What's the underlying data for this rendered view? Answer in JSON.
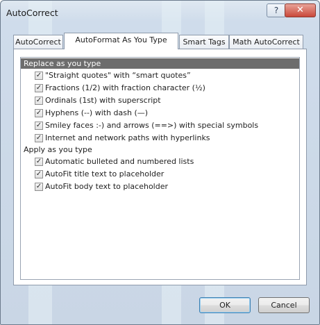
{
  "window": {
    "title": "AutoCorrect"
  },
  "titlebar": {
    "help_glyph": "?",
    "close_glyph": "✕"
  },
  "tabs": [
    {
      "label": "AutoCorrect",
      "active": false
    },
    {
      "label": "AutoFormat As You Type",
      "active": true
    },
    {
      "label": "Smart Tags",
      "active": false
    },
    {
      "label": "Math AutoCorrect",
      "active": false
    }
  ],
  "groups": {
    "replace": {
      "label": "Replace as you type",
      "selected": true,
      "items": [
        {
          "label": "\"Straight quotes\" with “smart quotes”",
          "checked": true
        },
        {
          "label": "Fractions (1/2) with fraction character (½)",
          "checked": true
        },
        {
          "label": "Ordinals (1st) with superscript",
          "checked": true
        },
        {
          "label": "Hyphens (--) with dash (—)",
          "checked": true
        },
        {
          "label": "Smiley faces :-) and arrows (==>) with special symbols",
          "checked": true
        },
        {
          "label": "Internet and network paths with hyperlinks",
          "checked": true
        }
      ]
    },
    "apply": {
      "label": "Apply as you type",
      "selected": false,
      "items": [
        {
          "label": "Automatic bulleted and numbered lists",
          "checked": true
        },
        {
          "label": "AutoFit title text to placeholder",
          "checked": true
        },
        {
          "label": "AutoFit body text to placeholder",
          "checked": true
        }
      ]
    }
  },
  "buttons": {
    "ok": "OK",
    "cancel": "Cancel"
  },
  "checkmark_glyph": "✓",
  "colors": {
    "selected_header_bg": "#6d6d6d",
    "selected_header_fg": "#ffffff",
    "close_red": "#c9483a"
  }
}
